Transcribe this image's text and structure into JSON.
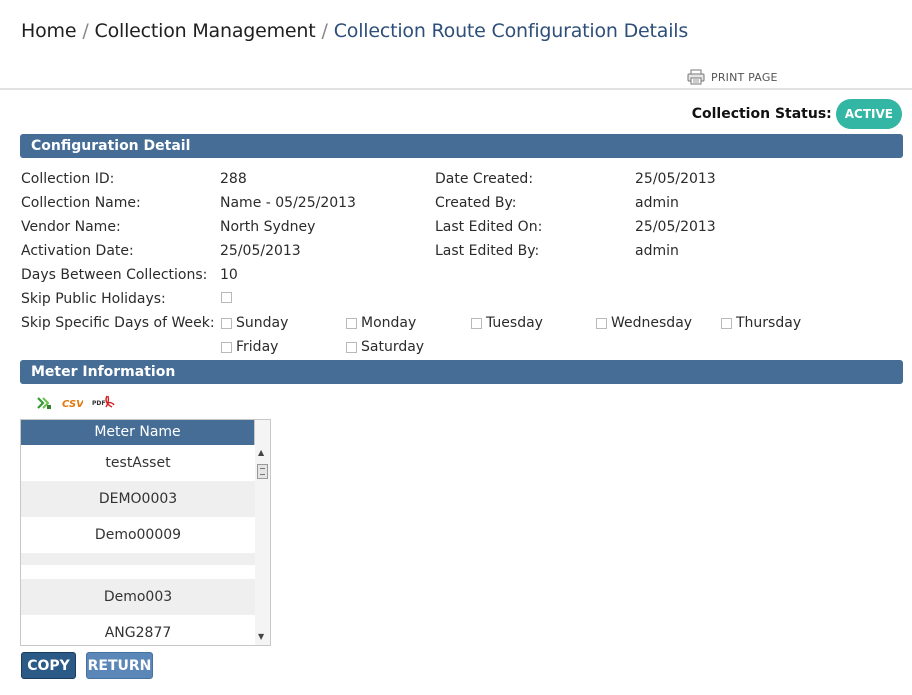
{
  "breadcrumb": {
    "home": "Home",
    "separator": "/",
    "section": "Collection Management",
    "current": "Collection Route Configuration Details"
  },
  "print": {
    "label": "PRINT PAGE",
    "icon": "printer-icon"
  },
  "status": {
    "label": "Collection Status:",
    "value": "ACTIVE",
    "color": "#33b6a4"
  },
  "config": {
    "title": "Configuration Detail",
    "left": [
      {
        "label": "Collection ID:",
        "value": "288"
      },
      {
        "label": "Collection Name:",
        "value": "Name - 05/25/2013"
      },
      {
        "label": "Vendor Name:",
        "value": "North Sydney"
      },
      {
        "label": "Activation Date:",
        "value": "25/05/2013"
      },
      {
        "label": "Days Between Collections:",
        "value": "10"
      },
      {
        "label": "Skip Public Holidays:",
        "value": ""
      }
    ],
    "right": [
      {
        "label": "Date Created:",
        "value": "25/05/2013"
      },
      {
        "label": "Created By:",
        "value": "admin"
      },
      {
        "label": "Last Edited On:",
        "value": "25/05/2013"
      },
      {
        "label": "Last Edited By:",
        "value": "admin"
      }
    ],
    "skip_days_label": "Skip Specific Days of Week:",
    "days": [
      "Sunday",
      "Monday",
      "Tuesday",
      "Wednesday",
      "Thursday",
      "Friday",
      "Saturday"
    ]
  },
  "meter": {
    "title": "Meter Information",
    "export_icons": [
      "excel-export-icon",
      "csv-export-icon",
      "pdf-export-icon"
    ],
    "csv_label": "CSV",
    "pdf_label": "PDF",
    "column": "Meter Name",
    "rows": [
      "testAsset",
      "DEMO0003",
      "Demo00009",
      "",
      "Demo003",
      "ANG2877"
    ]
  },
  "buttons": {
    "copy": "COPY",
    "return": "RETURN"
  },
  "colors": {
    "section_bar": "#456d96",
    "crumb_current": "#2e4f7a",
    "copy_button": "#2c5a86",
    "return_button": "#5b87b8"
  }
}
